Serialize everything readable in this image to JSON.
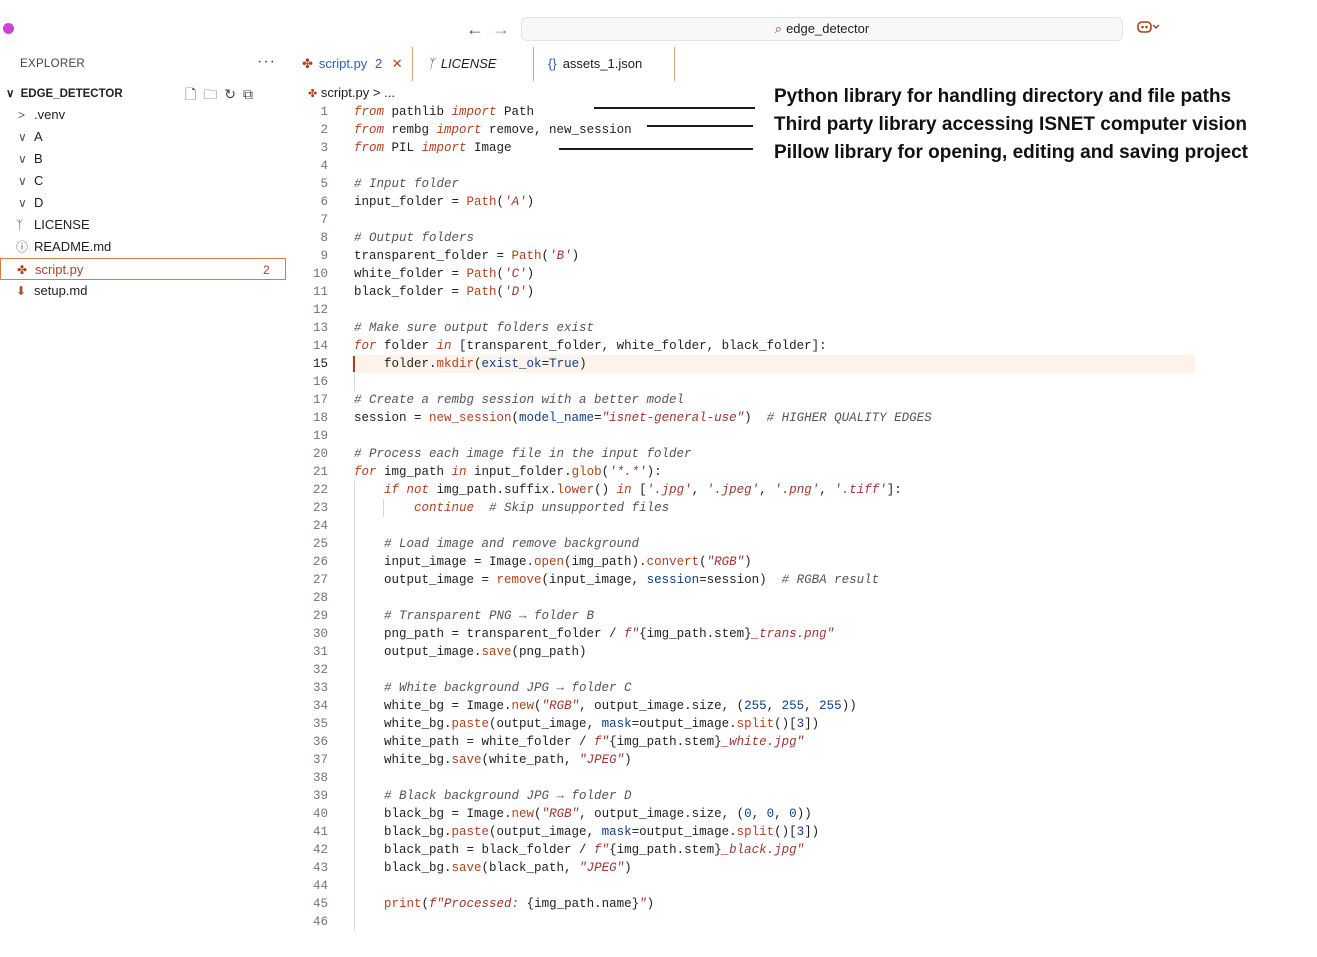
{
  "titlebar": {
    "back": "←",
    "forward": "→",
    "search_icon": "⌕",
    "search_text": "edge_detector",
    "copilot_icon": "copilot-icon"
  },
  "explorer": {
    "title": "EXPLORER",
    "more": "···",
    "root_chevron": "∨",
    "root_label": "EDGE_DETECTOR",
    "items": [
      {
        "type": "folder",
        "chev": ">",
        "label": ".venv"
      },
      {
        "type": "folder",
        "chev": "∨",
        "label": "A"
      },
      {
        "type": "folder",
        "chev": "∨",
        "label": "B"
      },
      {
        "type": "folder",
        "chev": "∨",
        "label": "C"
      },
      {
        "type": "folder",
        "chev": "∨",
        "label": "D"
      },
      {
        "type": "file",
        "icon": "license-icon",
        "glyph": "ᛉ",
        "label": "LICENSE"
      },
      {
        "type": "file",
        "icon": "info-icon",
        "glyph": "ⓘ",
        "label": "README.md"
      },
      {
        "type": "file",
        "icon": "python-icon",
        "glyph": "✤",
        "label": "script.py",
        "badge": "2",
        "selected": true
      },
      {
        "type": "file",
        "icon": "download-icon",
        "glyph": "⬇",
        "label": "setup.md"
      }
    ]
  },
  "tabs": [
    {
      "icon": "✤",
      "label": "script.py",
      "badge": "2",
      "close": "✕"
    },
    {
      "icon": "ᛉ",
      "label": "LICENSE"
    },
    {
      "icon": "{}",
      "label": "assets_1.json"
    }
  ],
  "breadcrumb": {
    "icon": "✤",
    "file": "script.py",
    "sep": ">",
    "rest": "..."
  },
  "code": {
    "current_line": 15,
    "lines": [
      "<span class=\"kw\">from</span> pathlib <span class=\"kw\">import</span> Path",
      "<span class=\"kw\">from</span> rembg <span class=\"kw\">import</span> remove, new_session",
      "<span class=\"kw\">from</span> PIL <span class=\"kw\">import</span> Image",
      "",
      "<span class=\"cm\"># Input folder</span>",
      "input_folder = <span class=\"fn\">Path</span>(<span class=\"str\">'A'</span>)",
      "",
      "<span class=\"cm\"># Output folders</span>",
      "transparent_folder = <span class=\"fn\">Path</span>(<span class=\"str\">'B'</span>)",
      "white_folder = <span class=\"fn\">Path</span>(<span class=\"str\">'C'</span>)",
      "black_folder = <span class=\"fn\">Path</span>(<span class=\"str\">'D'</span>)",
      "",
      "<span class=\"cm\"># Make sure output folders exist</span>",
      "<span class=\"kw\">for</span> folder <span class=\"kw\">in</span> [transparent_folder, white_folder, black_folder]:",
      "    folder.<span class=\"fn\">mkdir</span>(<span class=\"cls\">exist_ok</span>=<span class=\"cls\">True</span>)",
      "",
      "<span class=\"cm\"># Create a rembg session with a better model</span>",
      "session = <span class=\"fn\">new_session</span>(<span class=\"cls\">model_name</span>=<span class=\"str\">\"isnet-general-use\"</span>)  <span class=\"cm\"># HIGHER QUALITY EDGES</span>",
      "",
      "<span class=\"cm\"># Process each image file in the input folder</span>",
      "<span class=\"kw\">for</span> img_path <span class=\"kw\">in</span> input_folder.<span class=\"fn\">glob</span>(<span class=\"str\">'*.*'</span>):",
      "    <span class=\"kw\">if not</span> img_path.suffix.<span class=\"fn\">lower</span>() <span class=\"kw\">in</span> [<span class=\"str\">'.jpg'</span>, <span class=\"str\">'.jpeg'</span>, <span class=\"str\">'.png'</span>, <span class=\"str\">'.tiff'</span>]:",
      "        <span class=\"kw\">continue</span>  <span class=\"cm\"># Skip unsupported files</span>",
      "",
      "    <span class=\"cm\"># Load image and remove background</span>",
      "    input_image = Image.<span class=\"fn\">open</span>(img_path).<span class=\"fn\">convert</span>(<span class=\"str\">\"RGB\"</span>)",
      "    output_image = <span class=\"fn\">remove</span>(input_image, <span class=\"cls\">session</span>=session)  <span class=\"cm\"># RGBA result</span>",
      "",
      "    <span class=\"cm\"># Transparent PNG → folder B</span>",
      "    png_path = transparent_folder / <span class=\"str\">f\"</span>{img_path.stem}<span class=\"str\">_trans.png\"</span>",
      "    output_image.<span class=\"fn\">save</span>(png_path)",
      "",
      "    <span class=\"cm\"># White background JPG → folder C</span>",
      "    white_bg = Image.<span class=\"fn\">new</span>(<span class=\"str\">\"RGB\"</span>, output_image.size, (<span class=\"num2\">255</span>, <span class=\"num2\">255</span>, <span class=\"num2\">255</span>))",
      "    white_bg.<span class=\"fn\">paste</span>(output_image, <span class=\"cls\">mask</span>=output_image.<span class=\"fn\">split</span>()[<span class=\"num2\">3</span>])",
      "    white_path = white_folder / <span class=\"str\">f\"</span>{img_path.stem}<span class=\"str\">_white.jpg\"</span>",
      "    white_bg.<span class=\"fn\">save</span>(white_path, <span class=\"str\">\"JPEG\"</span>)",
      "",
      "    <span class=\"cm\"># Black background JPG → folder D</span>",
      "    black_bg = Image.<span class=\"fn\">new</span>(<span class=\"str\">\"RGB\"</span>, output_image.size, (<span class=\"num2\">0</span>, <span class=\"num2\">0</span>, <span class=\"num2\">0</span>))",
      "    black_bg.<span class=\"fn\">paste</span>(output_image, <span class=\"cls\">mask</span>=output_image.<span class=\"fn\">split</span>()[<span class=\"num2\">3</span>])",
      "    black_path = black_folder / <span class=\"str\">f\"</span>{img_path.stem}<span class=\"str\">_black.jpg\"</span>",
      "    black_bg.<span class=\"fn\">save</span>(black_path, <span class=\"str\">\"JPEG\"</span>)",
      "",
      "    <span class=\"fn\">print</span>(<span class=\"str\">f\"Processed: </span>{img_path.name}<span class=\"str\">\"</span>)",
      ""
    ]
  },
  "annotations": [
    "Python library for handling directory and file paths",
    "Third party library accessing ISNET computer vision",
    "Pillow library for opening, editing and saving project"
  ]
}
